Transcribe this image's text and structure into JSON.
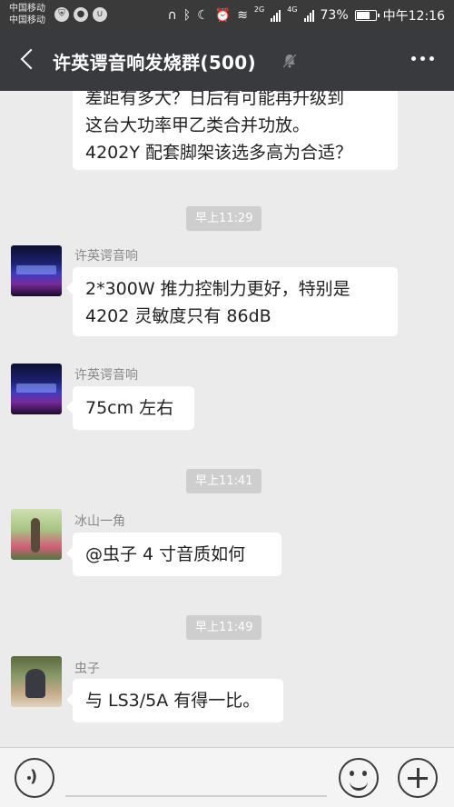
{
  "status_bar": {
    "carrier_1": "中国移动",
    "carrier_2": "中国移动",
    "network_1": "2G",
    "network_2": "4G",
    "battery_text": "73%",
    "time": "中午12:16",
    "battery_level_pct": 73
  },
  "header": {
    "title": "许英谔音响发烧群(500)",
    "icons": [
      "back-arrow-icon",
      "mute-bell-icon",
      "more-dots-icon"
    ]
  },
  "messages": [
    {
      "type": "text",
      "sender": "",
      "lines": [
        "差距有多大？日后有可能再升级到",
        "这台大功率甲乙类合并功放。",
        "4202Y 配套脚架该选多高为合适？"
      ]
    },
    {
      "type": "time",
      "text": "早上11:29"
    },
    {
      "type": "text",
      "sender": "许英谔音响",
      "avatar": "stage-avatar",
      "lines": [
        "2*300W 推力控制力更好，特别是",
        "4202 灵敏度只有 86dB"
      ]
    },
    {
      "type": "text",
      "sender": "许英谔音响",
      "avatar": "stage-avatar",
      "lines": [
        "75cm 左右"
      ]
    },
    {
      "type": "time",
      "text": "早上11:41"
    },
    {
      "type": "text",
      "sender": "冰山一角",
      "avatar": "park-avatar",
      "lines": [
        "@虫子  4 寸音质如何"
      ]
    },
    {
      "type": "time",
      "text": "早上11:49"
    },
    {
      "type": "text",
      "sender": "虫子",
      "avatar": "kid-avatar",
      "lines": [
        "与 LS3/5A 有得一比。"
      ]
    }
  ],
  "input_bar": {
    "icons": [
      "voice-icon",
      "emoji-icon",
      "plus-icon"
    ]
  },
  "colors": {
    "title_bar": "#393a3e",
    "status_bar": "#3a3a3a",
    "chat_bg": "#ebebeb",
    "bubble": "#ffffff",
    "time_badge": "#cecece"
  }
}
